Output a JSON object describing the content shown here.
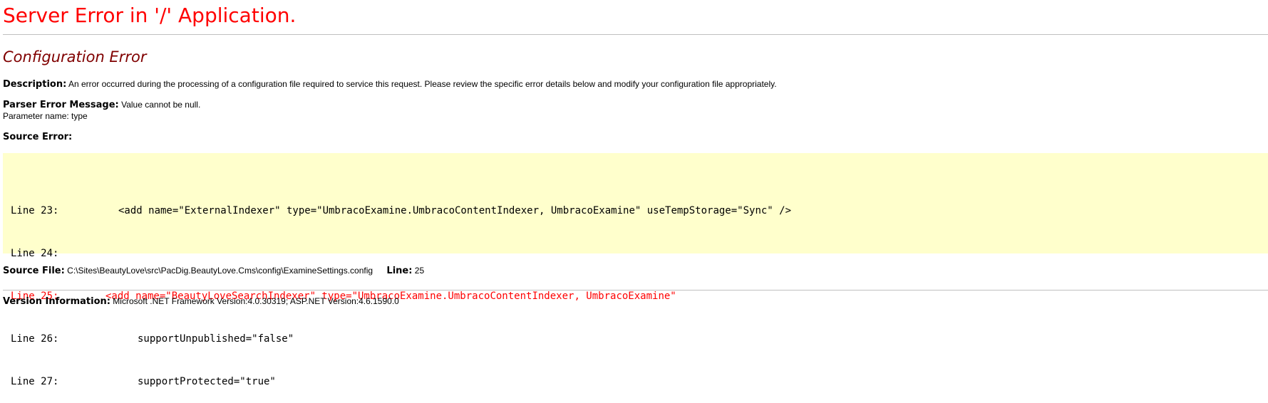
{
  "title": "Server Error in '/' Application.",
  "error_type": "Configuration Error",
  "description": {
    "label": "Description:",
    "text": "An error occurred during the processing of a configuration file required to service this request. Please review the specific error details below and modify your configuration file appropriately."
  },
  "parser_error": {
    "label": "Parser Error Message:",
    "text": "Value cannot be null.",
    "detail": "Parameter name: type"
  },
  "source_error": {
    "label": "Source Error:",
    "lines": [
      {
        "number": "Line 23:",
        "code": "<add name=\"ExternalIndexer\" type=\"UmbracoExamine.UmbracoContentIndexer, UmbracoExamine\" useTempStorage=\"Sync\" />",
        "highlighted": false
      },
      {
        "number": "Line 24:",
        "code": "",
        "highlighted": false
      },
      {
        "number": "Line 25:",
        "code": "<add name=\"BeautyLoveSearchIndexer\" type=\"UmbracoExamine.UmbracoContentIndexer, UmbracoExamine\"",
        "highlighted": true
      },
      {
        "number": "Line 26:",
        "code": "supportUnpublished=\"false\"",
        "highlighted": false
      },
      {
        "number": "Line 27:",
        "code": "supportProtected=\"true\"",
        "highlighted": false
      }
    ]
  },
  "source_file": {
    "label": "Source File:",
    "path": "C:\\Sites\\BeautyLove\\src\\PacDig.BeautyLove.Cms\\config\\ExamineSettings.config",
    "line_label": "Line:",
    "line_value": "25"
  },
  "version_info": {
    "label": "Version Information:",
    "text": "Microsoft .NET Framework Version:4.0.30319; ASP.NET Version:4.6.1590.0"
  },
  "colors": {
    "title": "#ff0000",
    "subtitle": "#800000",
    "code_background": "#ffffcc",
    "error_line": "#ff0000",
    "rule": "#c0c0c0"
  }
}
